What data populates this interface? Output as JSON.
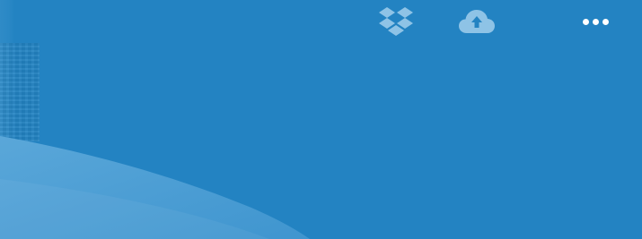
{
  "colors": {
    "background": "#2383c2",
    "icon_muted": "#8ec3e6",
    "icon_white": "#ffffff",
    "wave_light": "#5aa7d9"
  },
  "toolbar": {
    "icons": [
      "dropbox-icon",
      "cloud-upload-icon",
      "more-options-icon"
    ]
  }
}
